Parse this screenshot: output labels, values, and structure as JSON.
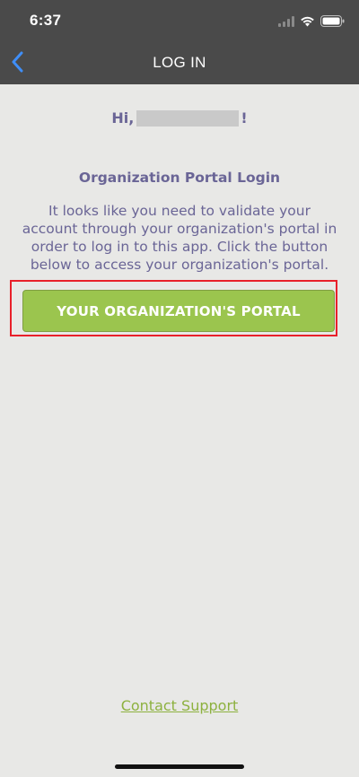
{
  "status_bar": {
    "time": "6:37"
  },
  "nav": {
    "title": "LOG IN",
    "back_icon": "chevron-left-icon"
  },
  "greeting": {
    "prefix": "Hi,",
    "suffix": "!"
  },
  "portal": {
    "heading": "Organization Portal Login",
    "instructions": "It looks like you need to validate your account through your organization's portal in order to log in to this app. Click the button below to access your organization's portal.",
    "button_label": "YOUR ORGANIZATION'S PORTAL"
  },
  "footer": {
    "contact_support": "Contact Support"
  },
  "colors": {
    "header_bg": "#4a4a4a",
    "page_bg": "#e8e8e6",
    "text_purple": "#6a6596",
    "button_green": "#9bc54e",
    "link_green": "#8db13f",
    "back_blue": "#3f8ef7",
    "highlight_red": "#e8202a"
  }
}
